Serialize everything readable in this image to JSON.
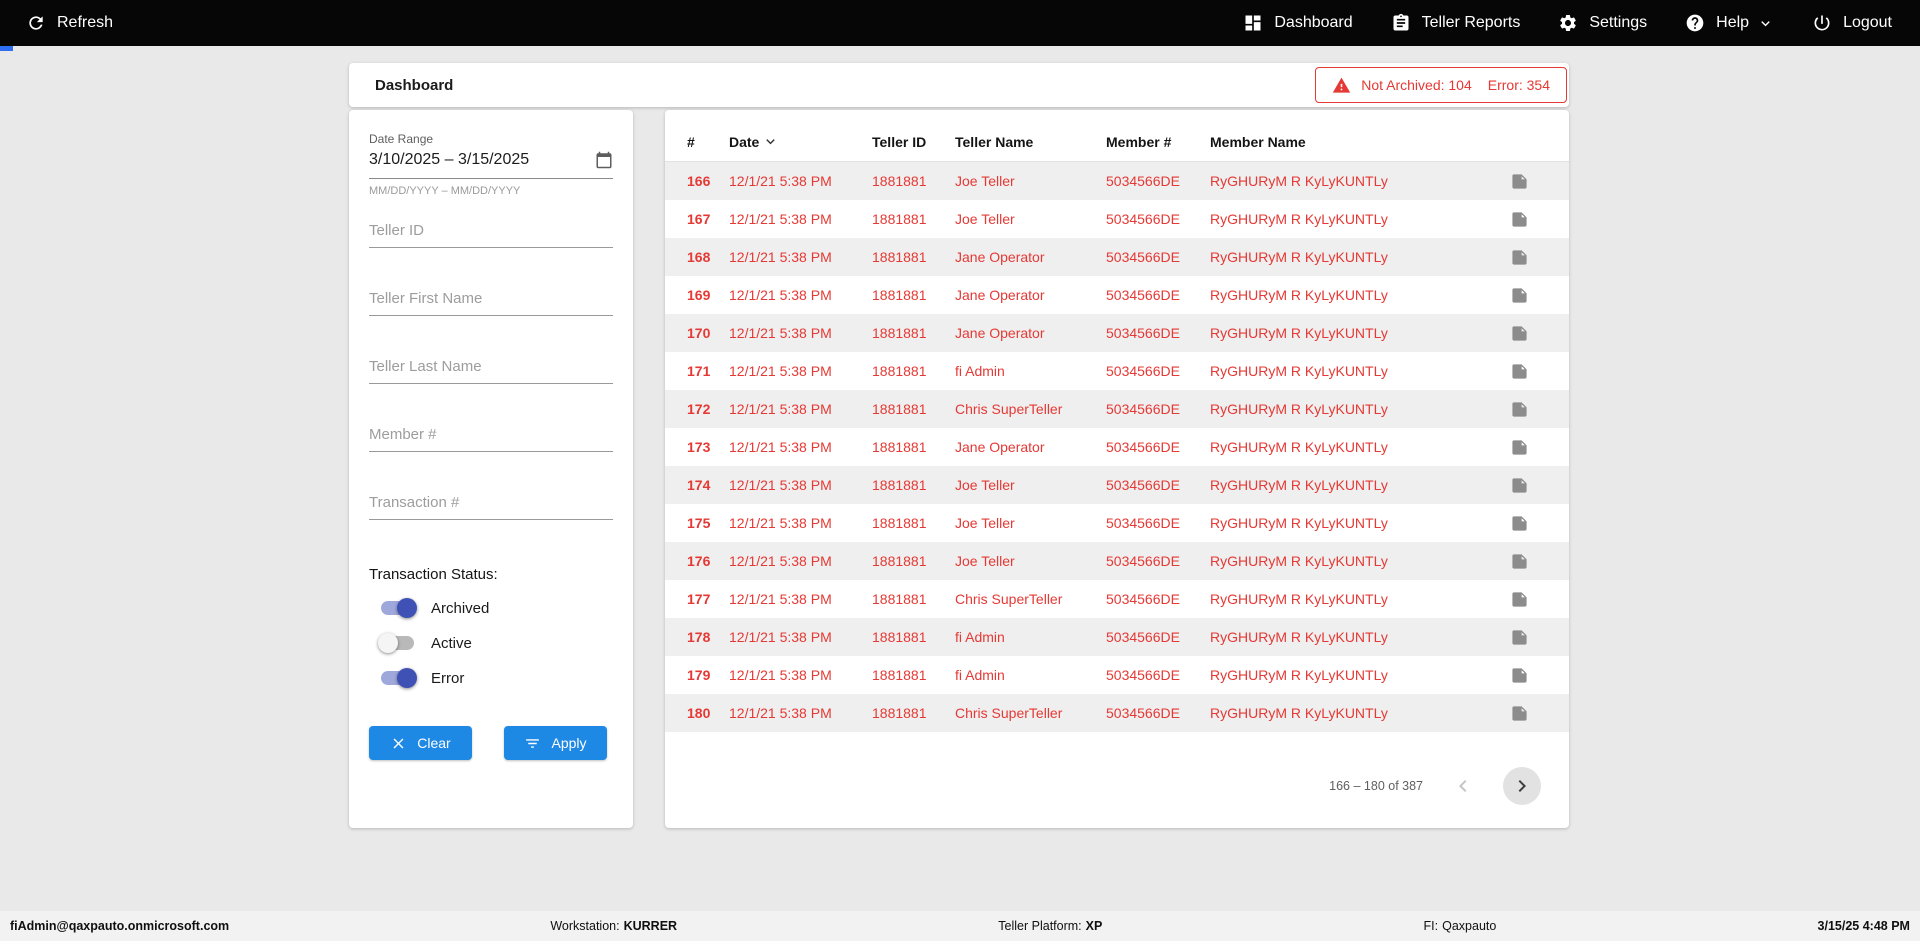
{
  "navbar": {
    "refresh_label": "Refresh",
    "dashboard_label": "Dashboard",
    "teller_reports_label": "Teller Reports",
    "settings_label": "Settings",
    "help_label": "Help",
    "logout_label": "Logout"
  },
  "page": {
    "title": "Dashboard"
  },
  "alert": {
    "not_archived": "Not Archived: 104",
    "error": "Error: 354"
  },
  "filters": {
    "date_range": {
      "label": "Date Range",
      "value": "3/10/2025 – 3/15/2025",
      "helper": "MM/DD/YYYY – MM/DD/YYYY"
    },
    "teller_id_placeholder": "Teller ID",
    "teller_first_placeholder": "Teller First Name",
    "teller_last_placeholder": "Teller Last Name",
    "member_placeholder": "Member #",
    "transaction_placeholder": "Transaction #",
    "status": {
      "label": "Transaction Status:",
      "toggles": [
        {
          "label": "Archived",
          "on": true
        },
        {
          "label": "Active",
          "on": false
        },
        {
          "label": "Error",
          "on": true
        }
      ]
    },
    "clear_label": "Clear",
    "apply_label": "Apply"
  },
  "table": {
    "columns": [
      "#",
      "Date",
      "Teller ID",
      "Teller Name",
      "Member #",
      "Member Name"
    ],
    "rows": [
      {
        "num": "166",
        "date": "12/1/21 5:38 PM",
        "teller_id": "1881881",
        "teller_name": "Joe Teller",
        "member_num": "5034566DE",
        "member_name": "RyGHURyM R KyLyKUNTLy"
      },
      {
        "num": "167",
        "date": "12/1/21 5:38 PM",
        "teller_id": "1881881",
        "teller_name": "Joe Teller",
        "member_num": "5034566DE",
        "member_name": "RyGHURyM R KyLyKUNTLy"
      },
      {
        "num": "168",
        "date": "12/1/21 5:38 PM",
        "teller_id": "1881881",
        "teller_name": "Jane Operator",
        "member_num": "5034566DE",
        "member_name": "RyGHURyM R KyLyKUNTLy"
      },
      {
        "num": "169",
        "date": "12/1/21 5:38 PM",
        "teller_id": "1881881",
        "teller_name": "Jane Operator",
        "member_num": "5034566DE",
        "member_name": "RyGHURyM R KyLyKUNTLy"
      },
      {
        "num": "170",
        "date": "12/1/21 5:38 PM",
        "teller_id": "1881881",
        "teller_name": "Jane Operator",
        "member_num": "5034566DE",
        "member_name": "RyGHURyM R KyLyKUNTLy"
      },
      {
        "num": "171",
        "date": "12/1/21 5:38 PM",
        "teller_id": "1881881",
        "teller_name": "fi Admin",
        "member_num": "5034566DE",
        "member_name": "RyGHURyM R KyLyKUNTLy"
      },
      {
        "num": "172",
        "date": "12/1/21 5:38 PM",
        "teller_id": "1881881",
        "teller_name": "Chris SuperTeller",
        "member_num": "5034566DE",
        "member_name": "RyGHURyM R KyLyKUNTLy"
      },
      {
        "num": "173",
        "date": "12/1/21 5:38 PM",
        "teller_id": "1881881",
        "teller_name": "Jane Operator",
        "member_num": "5034566DE",
        "member_name": "RyGHURyM R KyLyKUNTLy"
      },
      {
        "num": "174",
        "date": "12/1/21 5:38 PM",
        "teller_id": "1881881",
        "teller_name": "Joe Teller",
        "member_num": "5034566DE",
        "member_name": "RyGHURyM R KyLyKUNTLy"
      },
      {
        "num": "175",
        "date": "12/1/21 5:38 PM",
        "teller_id": "1881881",
        "teller_name": "Joe Teller",
        "member_num": "5034566DE",
        "member_name": "RyGHURyM R KyLyKUNTLy"
      },
      {
        "num": "176",
        "date": "12/1/21 5:38 PM",
        "teller_id": "1881881",
        "teller_name": "Joe Teller",
        "member_num": "5034566DE",
        "member_name": "RyGHURyM R KyLyKUNTLy"
      },
      {
        "num": "177",
        "date": "12/1/21 5:38 PM",
        "teller_id": "1881881",
        "teller_name": "Chris SuperTeller",
        "member_num": "5034566DE",
        "member_name": "RyGHURyM R KyLyKUNTLy"
      },
      {
        "num": "178",
        "date": "12/1/21 5:38 PM",
        "teller_id": "1881881",
        "teller_name": "fi Admin",
        "member_num": "5034566DE",
        "member_name": "RyGHURyM R KyLyKUNTLy"
      },
      {
        "num": "179",
        "date": "12/1/21 5:38 PM",
        "teller_id": "1881881",
        "teller_name": "fi Admin",
        "member_num": "5034566DE",
        "member_name": "RyGHURyM R KyLyKUNTLy"
      },
      {
        "num": "180",
        "date": "12/1/21 5:38 PM",
        "teller_id": "1881881",
        "teller_name": "Chris SuperTeller",
        "member_num": "5034566DE",
        "member_name": "RyGHURyM R KyLyKUNTLy"
      }
    ],
    "pagination": {
      "range_label": "166 – 180 of 387"
    }
  },
  "footer": {
    "user": "fiAdmin@qaxpauto.onmicrosoft.com",
    "workstation_label": "Workstation:",
    "workstation_value": "KURRER",
    "platform_label": "Teller Platform:",
    "platform_value": "XP",
    "fi_label": "FI:",
    "fi_value": "Qaxpauto",
    "datetime": "3/15/25 4:48 PM"
  },
  "colors": {
    "accent_blue": "#1e88e5",
    "error_red": "#e53935",
    "toggle_blue": "#3f51b5",
    "navbar_black": "#060606"
  }
}
